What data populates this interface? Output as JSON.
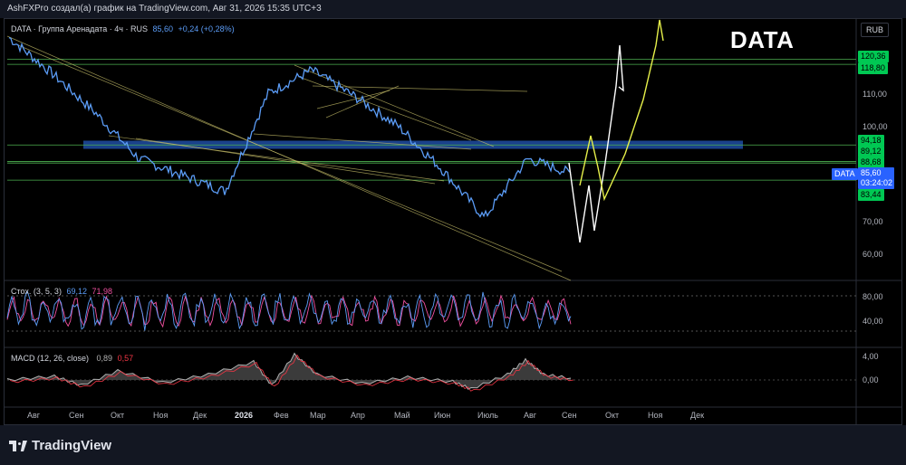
{
  "header": {
    "attribution": "AshFXPro создал(а) график на TradingView.com, Авг 31, 2026 15:35 UTC+3"
  },
  "legend": {
    "symbol": "DATA · Группа Аренадата · 4ч · RUS",
    "price": "85,60",
    "change": "+0,24 (+0,28%)"
  },
  "watermark": "DATA",
  "currency": "RUB",
  "brand": "TradingView",
  "price_labels": {
    "l120": "120,36",
    "l118": "118,80",
    "l94": "94,18",
    "l89": "89,12",
    "l88": "88,68",
    "cur_symbol": "DATA",
    "cur_price": "85,60",
    "cur_timer": "03:24:02",
    "l83": "83,44"
  },
  "price_ticks": [
    "110,00",
    "100,00",
    "70,00",
    "60,00"
  ],
  "stoch": {
    "label": "Стох. (3, 5, 3)",
    "k": "69,12",
    "d": "71,98",
    "ticks": [
      "80,00",
      "40,00"
    ]
  },
  "macd": {
    "label": "MACD (12, 26, close)",
    "macd": "0,89",
    "signal": "0,57",
    "ticks": [
      "4,00",
      "0,00"
    ]
  },
  "time_labels": [
    "Авг",
    "Сен",
    "Окт",
    "Ноя",
    "Дек",
    "2026",
    "Фев",
    "Мар",
    "Апр",
    "Май",
    "Июн",
    "Июль",
    "Авг",
    "Сен",
    "Окт",
    "Ноя",
    "Дек"
  ],
  "colors": {
    "price_line": "#5b9cf6",
    "green_level": "#4caf50",
    "green_tag": "#00c853",
    "blue_zone": "#1f4ea3",
    "trendline": "#c8c06a",
    "projection_white": "#ffffff",
    "projection_yellow": "#e6f04a",
    "stoch_k": "#5b9cf6",
    "stoch_d": "#f050a0",
    "macd_line": "#b0b0b0",
    "macd_signal": "#f23645"
  },
  "chart_data": {
    "type": "line",
    "title": "DATA · Группа Аренадата · 4ч · RUS",
    "ylim": [
      55,
      128
    ],
    "x": [
      "Авг",
      "Сен",
      "Окт",
      "Ноя",
      "Дек",
      "2026",
      "Фев",
      "Мар",
      "Апр",
      "Май",
      "Июн",
      "Июль",
      "Авг",
      "Сен"
    ],
    "series": [
      {
        "name": "DATA",
        "values": [
          127,
          116,
          104,
          90,
          85,
          80,
          110,
          117,
          109,
          100,
          87,
          72,
          90,
          85.6
        ]
      }
    ],
    "horizontal_levels": [
      120.36,
      118.8,
      94.18,
      89.12,
      88.68,
      83.44
    ],
    "zone": [
      93,
      95.5
    ],
    "grid": false,
    "legend_position": "top-left"
  }
}
